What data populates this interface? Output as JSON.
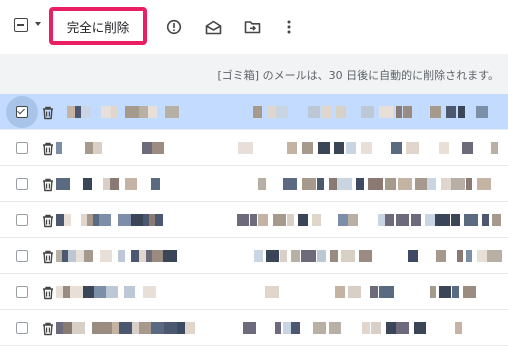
{
  "toolbar": {
    "delete_forever_label": "完全に削除",
    "icons": [
      "select-all-checkbox-icon",
      "select-menu-caret-icon",
      "report-spam-icon",
      "mark-unread-icon",
      "move-to-icon",
      "more-options-icon"
    ]
  },
  "banner": {
    "text": "[ゴミ箱] のメールは、30 日後に自動的に削除されます。"
  },
  "colors": {
    "accent_highlight": "#e91e63",
    "selected_row": "#c2dbff",
    "banner_bg": "#f1f3f4"
  },
  "rows": [
    {
      "selected": true
    },
    {
      "selected": false
    },
    {
      "selected": false
    },
    {
      "selected": false
    },
    {
      "selected": false
    },
    {
      "selected": false
    },
    {
      "selected": false
    }
  ]
}
